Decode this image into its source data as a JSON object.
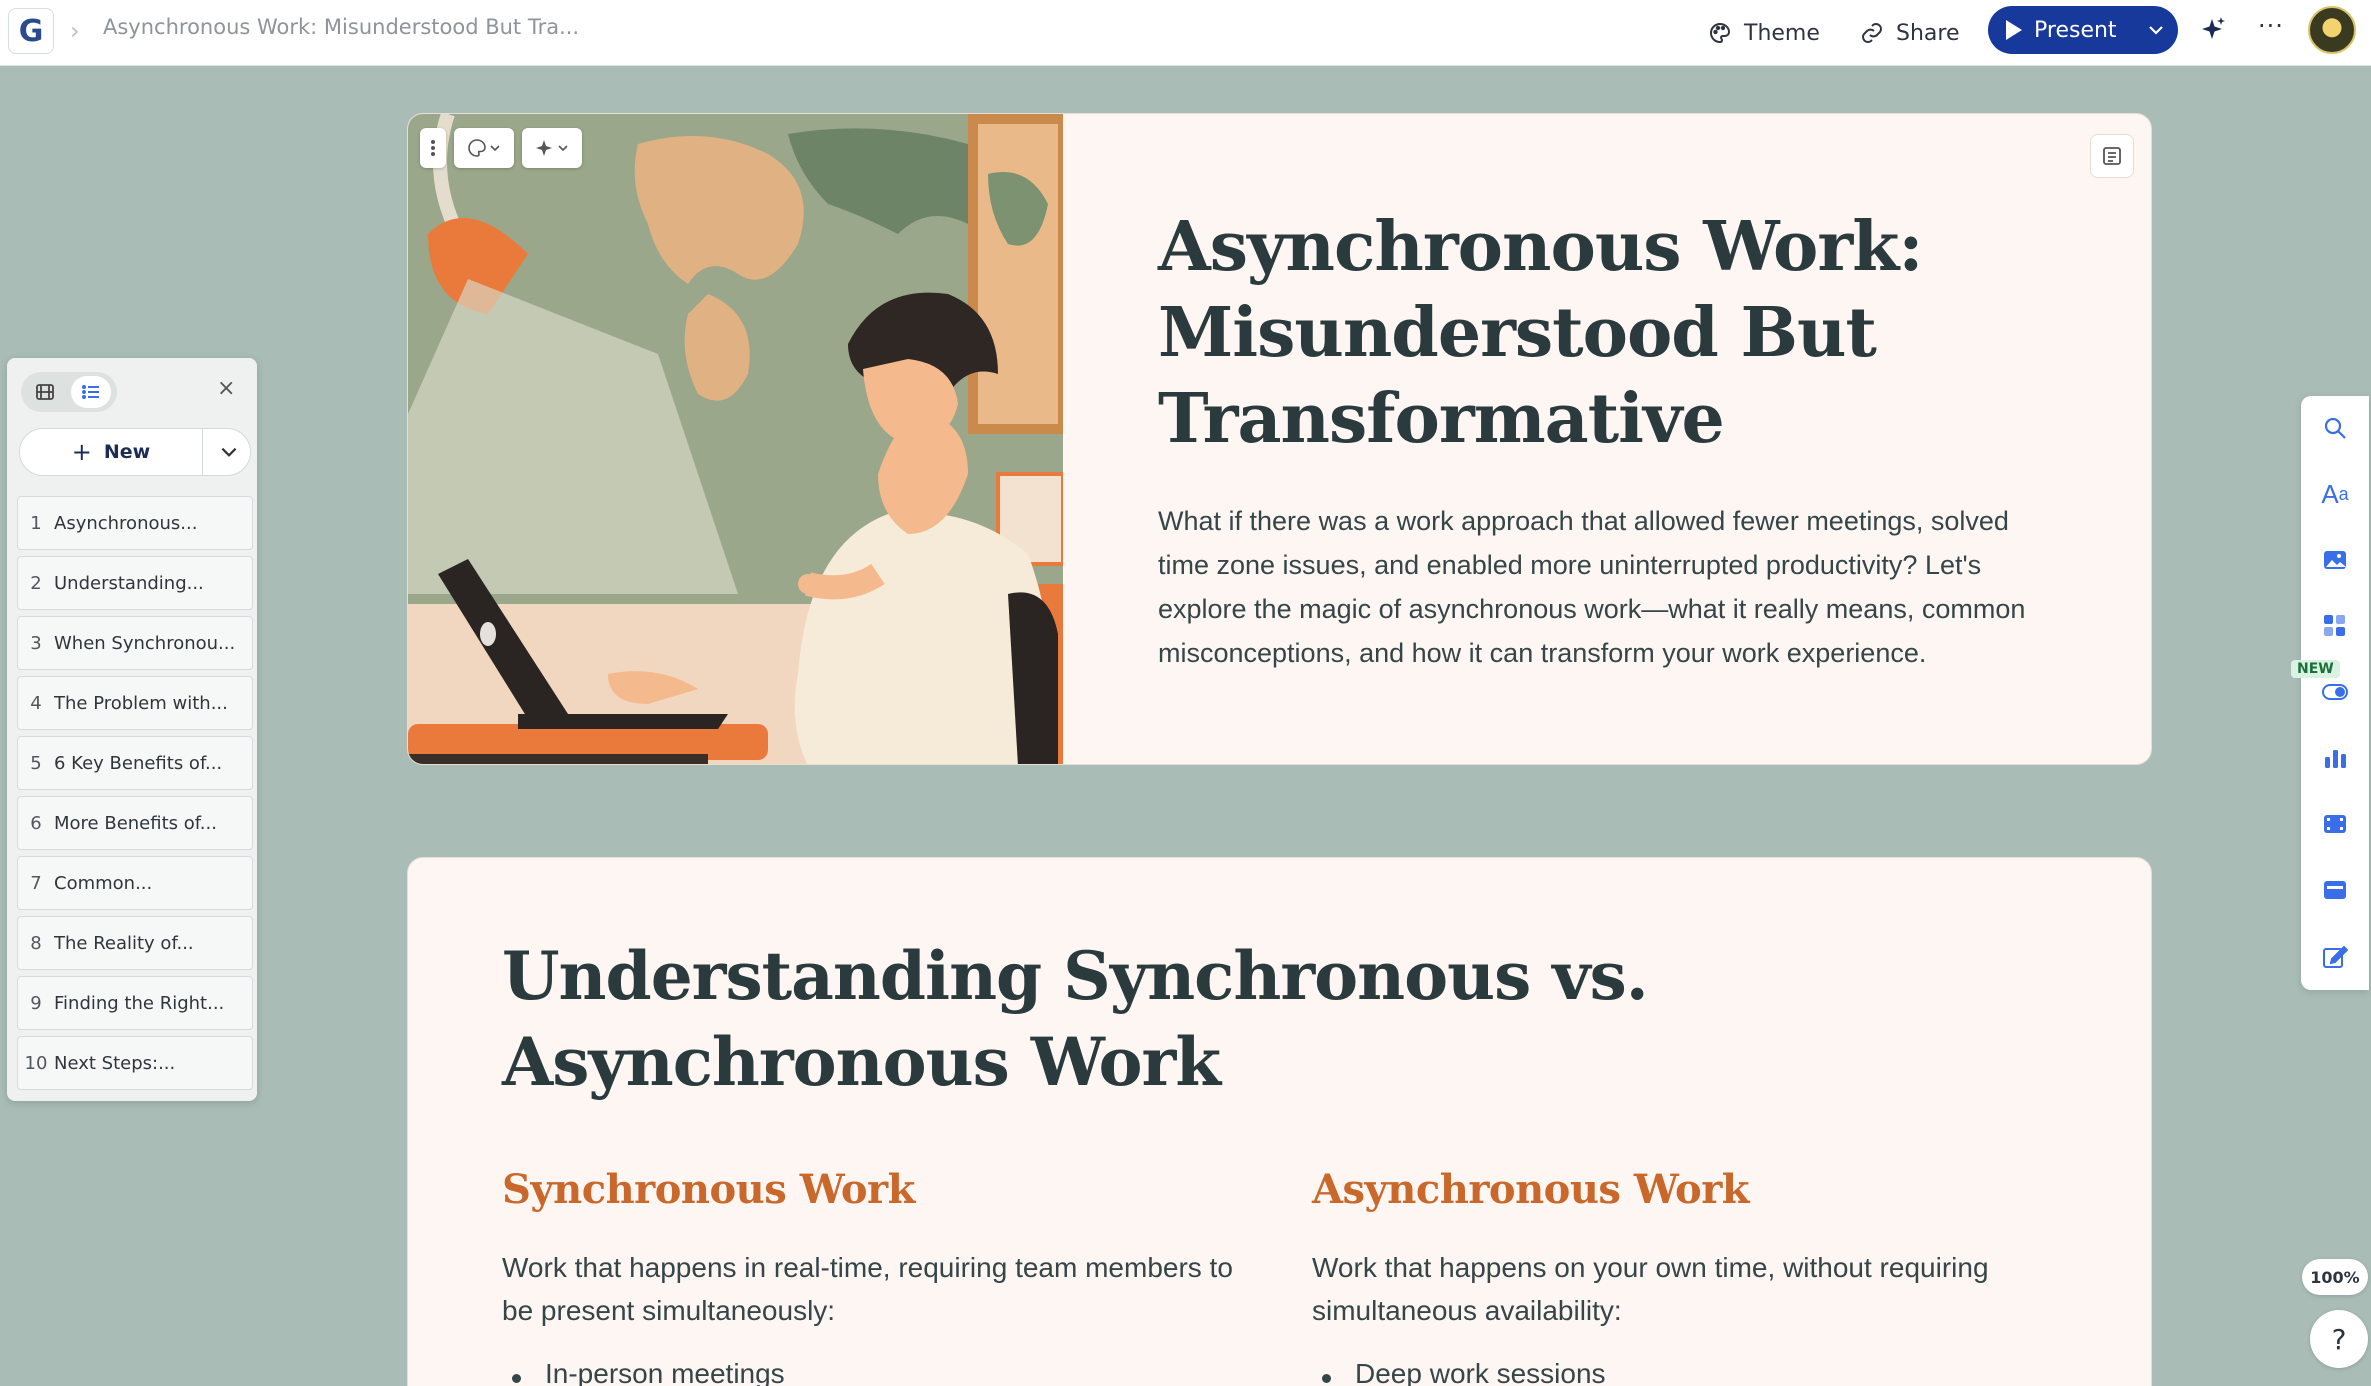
{
  "app": {
    "logo_letter": "G",
    "doc_title": "Asynchronous Work: Misunderstood But Tra..."
  },
  "topbar": {
    "theme_label": "Theme",
    "share_label": "Share",
    "present_label": "Present",
    "more_label": "···"
  },
  "panel": {
    "new_label": "New",
    "close_label": "×",
    "slides": [
      {
        "num": "1",
        "title": "Asynchronous..."
      },
      {
        "num": "2",
        "title": "Understanding..."
      },
      {
        "num": "3",
        "title": "When Synchronou..."
      },
      {
        "num": "4",
        "title": "The Problem with..."
      },
      {
        "num": "5",
        "title": "6 Key Benefits of..."
      },
      {
        "num": "6",
        "title": "More Benefits of..."
      },
      {
        "num": "7",
        "title": "Common..."
      },
      {
        "num": "8",
        "title": "The Reality of..."
      },
      {
        "num": "9",
        "title": "Finding the Right..."
      },
      {
        "num": "10",
        "title": "Next Steps:..."
      }
    ]
  },
  "card1": {
    "heading": "Asynchronous Work: Misunderstood But Transformative",
    "intro": "What if there was a work approach that allowed fewer meetings, solved time zone issues, and enabled more uninterrupted productivity? Let's explore the magic of asynchronous work—what it really means, common misconceptions, and how it can transform your work experience."
  },
  "card2": {
    "heading": "Understanding Synchronous vs. Asynchronous Work",
    "left": {
      "title": "Synchronous Work",
      "text": "Work that happens in real-time, requiring team members to be present simultaneously:",
      "bullet": "In-person meetings"
    },
    "right": {
      "title": "Asynchronous Work",
      "text": "Work that happens on your own time, without requiring simultaneous availability:",
      "bullet": "Deep work sessions"
    }
  },
  "right_toolbar": {
    "new_badge": "NEW",
    "zoom": "100%",
    "help": "?"
  },
  "colors": {
    "brand_blue": "#16399b",
    "accent_orange": "#c9682a",
    "canvas_bg": "#a9bcb6",
    "card_bg": "#fdf6f2"
  }
}
